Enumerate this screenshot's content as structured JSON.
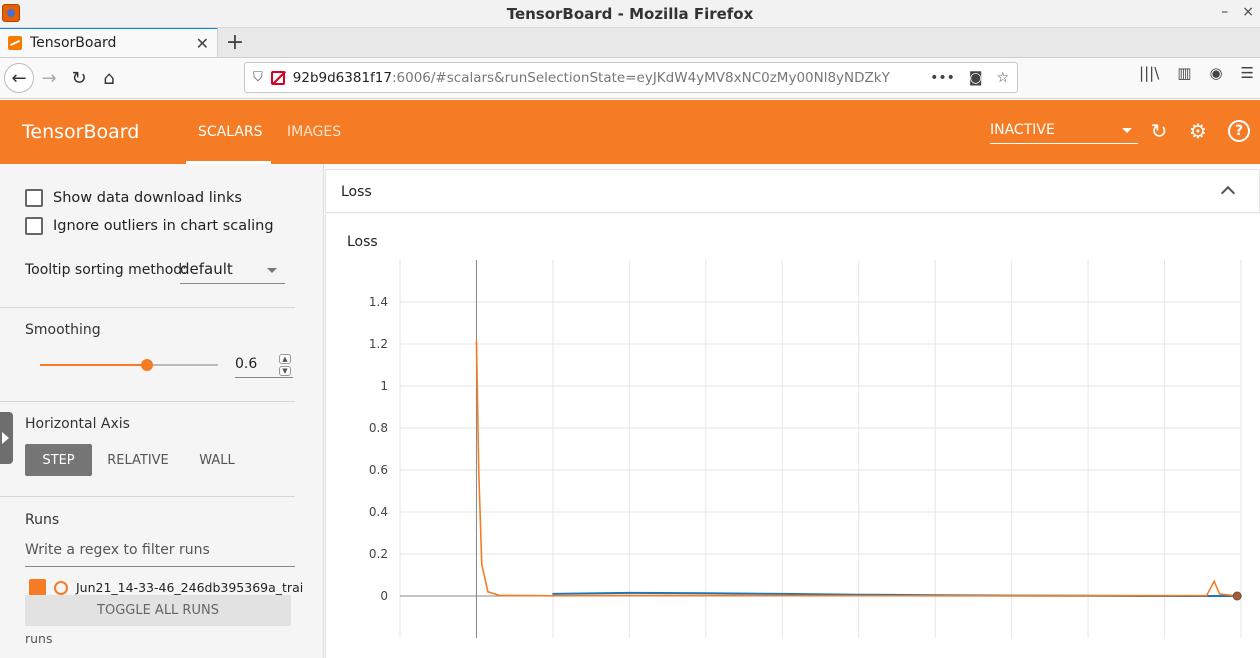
{
  "window": {
    "title": "TensorBoard - Mozilla Firefox",
    "controls": [
      "–",
      "×"
    ]
  },
  "browser": {
    "tab_title": "TensorBoard",
    "url_host": "92b9d6381f17",
    "url_rest": ":6006/#scalars&runSelectionState=eyJKdW4yMV8xNC0zMy00Nl8yNDZkY"
  },
  "toolbar": {
    "brand": "TensorBoard",
    "tabs": [
      "SCALARS",
      "IMAGES"
    ],
    "active_tab": "SCALARS",
    "status_select": "INACTIVE",
    "accent": "#f57c24"
  },
  "sidebar": {
    "show_download_links": "Show data download links",
    "ignore_outliers": "Ignore outliers in chart scaling",
    "tooltip_label": "Tooltip sorting method:",
    "tooltip_value": "default",
    "smoothing_label": "Smoothing",
    "smoothing_value": "0.6",
    "smoothing_fraction": 0.6,
    "horizontal_axis_label": "Horizontal Axis",
    "axis_options": [
      "STEP",
      "RELATIVE",
      "WALL"
    ],
    "runs_label": "Runs",
    "filter_placeholder": "Write a regex to filter runs",
    "run_name": "Jun21_14-33-46_246db395369a_trai",
    "toggle_all": "TOGGLE ALL RUNS",
    "runs_footer": "runs"
  },
  "card": {
    "header": "Loss",
    "chart_title": "Loss"
  },
  "chart_data": {
    "type": "line",
    "title": "Loss",
    "xlabel": "",
    "ylabel": "",
    "y_ticks": [
      "1.4",
      "1.2",
      "1",
      "0.8",
      "0.6",
      "0.4",
      "0.2",
      "0"
    ],
    "ylim": [
      -0.2,
      1.6
    ],
    "xlim": [
      -1,
      10
    ],
    "grid": true,
    "series": [
      {
        "color": "#1f77b4",
        "points": [
          [
            1,
            0.01
          ],
          [
            2,
            0.015
          ],
          [
            3,
            0.013
          ],
          [
            4,
            0.01
          ],
          [
            5,
            0.006
          ],
          [
            6,
            0.004
          ],
          [
            7,
            0.002
          ],
          [
            8,
            0.001
          ],
          [
            9,
            0.0
          ],
          [
            9.95,
            0.0
          ]
        ]
      },
      {
        "color": "#f57c24",
        "points": [
          [
            0,
            1.21
          ],
          [
            0.03,
            0.6
          ],
          [
            0.07,
            0.15
          ],
          [
            0.15,
            0.02
          ],
          [
            0.3,
            0.003
          ],
          [
            1,
            0.001
          ],
          [
            2,
            0.003
          ],
          [
            4,
            0.002
          ],
          [
            6,
            0.001
          ],
          [
            8,
            0.001
          ],
          [
            9.55,
            0.002
          ],
          [
            9.65,
            0.07
          ],
          [
            9.72,
            0.01
          ],
          [
            9.95,
            0.0
          ]
        ]
      }
    ]
  }
}
